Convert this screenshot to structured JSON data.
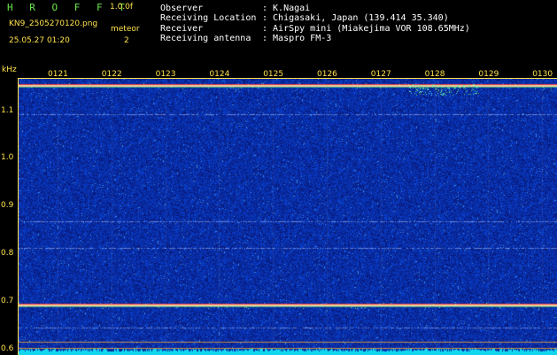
{
  "header": {
    "app_title": "H R O F F T",
    "version": "1.0.0f",
    "filename": "KN9_2505270120.png",
    "date_time": "25.05.27 01:20",
    "meteor_label": "meteor",
    "meteor_count": "2",
    "info_labels": [
      "Observer",
      "Receiving Location",
      "Receiver",
      "Receiving antenna"
    ],
    "info_values": [
      ": K.Nagai",
      ": Chigasaki, Japan (139.414 35.340)",
      ": AirSpy mini (Miakejima VOR 108.65MHz)",
      ": Maspro FM-3"
    ]
  },
  "chart_data": {
    "type": "heatmap",
    "ylabel": "kHz",
    "y_ticks": [
      "1.1",
      "1.0",
      "0.9",
      "0.8",
      "0.7",
      "0.6"
    ],
    "x_ticks": [
      "0121",
      "0122",
      "0123",
      "0124",
      "0125",
      "0126",
      "0127",
      "0128",
      "0129",
      "0130"
    ],
    "ylim": [
      0.59,
      1.17
    ],
    "strong_lines_khz": [
      1.155,
      0.695
    ],
    "faint_lines_khz": [
      1.095,
      0.87,
      0.815,
      0.648
    ],
    "colors": {
      "axis": "#ffe24a",
      "background_noise": "#0a1a8a",
      "signal_line": "#ffd7a0",
      "bottom_band": "#12d6f0"
    }
  }
}
